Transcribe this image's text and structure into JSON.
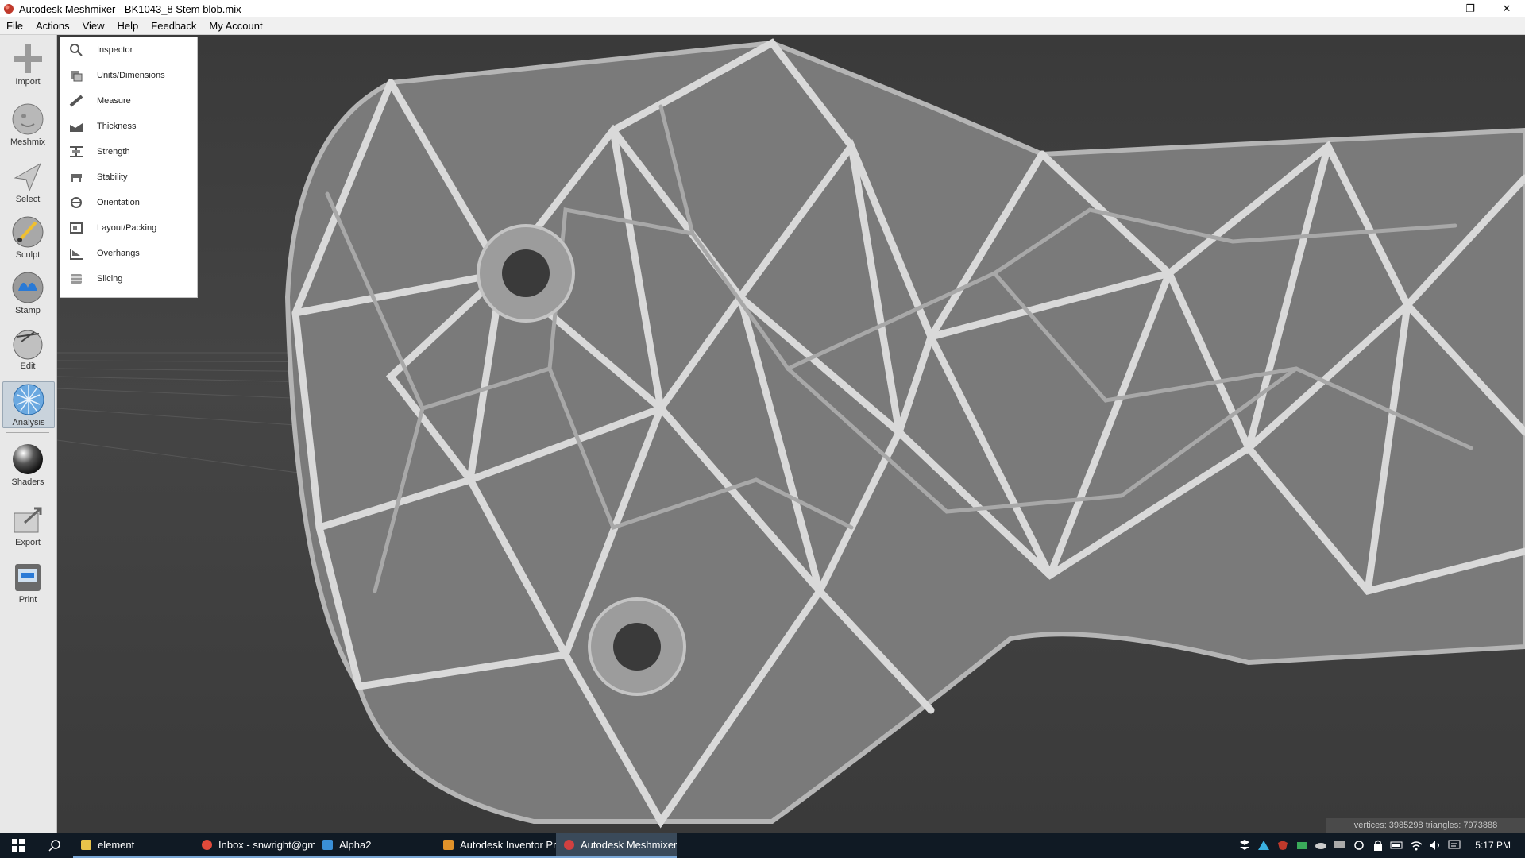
{
  "window": {
    "title": "Autodesk Meshmixer - BK1043_8 Stem blob.mix",
    "minimize_glyph": "—",
    "restore_glyph": "❐",
    "close_glyph": "✕"
  },
  "menubar": {
    "items": [
      "File",
      "Actions",
      "View",
      "Help",
      "Feedback",
      "My Account"
    ]
  },
  "toolbar": {
    "tools": [
      {
        "label": "Import",
        "icon": "import-icon"
      },
      {
        "label": "Meshmix",
        "icon": "meshmix-icon"
      },
      {
        "label": "Select",
        "icon": "select-icon"
      },
      {
        "label": "Sculpt",
        "icon": "sculpt-icon"
      },
      {
        "label": "Stamp",
        "icon": "stamp-icon"
      },
      {
        "label": "Edit",
        "icon": "edit-icon"
      },
      {
        "label": "Analysis",
        "icon": "analysis-icon",
        "active": true
      },
      {
        "label": "Shaders",
        "icon": "shaders-icon"
      },
      {
        "label": "Export",
        "icon": "export-icon"
      },
      {
        "label": "Print",
        "icon": "print-icon"
      }
    ]
  },
  "analysis_menu": {
    "items": [
      {
        "label": "Inspector",
        "icon": "inspector-icon"
      },
      {
        "label": "Units/Dimensions",
        "icon": "units-icon"
      },
      {
        "label": "Measure",
        "icon": "measure-icon"
      },
      {
        "label": "Thickness",
        "icon": "thickness-icon"
      },
      {
        "label": "Strength",
        "icon": "strength-icon"
      },
      {
        "label": "Stability",
        "icon": "stability-icon"
      },
      {
        "label": "Orientation",
        "icon": "orientation-icon"
      },
      {
        "label": "Layout/Packing",
        "icon": "layout-icon"
      },
      {
        "label": "Overhangs",
        "icon": "overhangs-icon"
      },
      {
        "label": "Slicing",
        "icon": "slicing-icon"
      }
    ]
  },
  "viewport": {
    "status": "vertices: 3985298 triangles: 7973888"
  },
  "taskbar": {
    "apps": [
      {
        "label": "element",
        "color": "#e8c34a"
      },
      {
        "label": "Inbox - snwright@gm...",
        "color": "#e04a3a"
      },
      {
        "label": "Alpha2",
        "color": "#3a8fd6"
      },
      {
        "label": "Autodesk Inventor Pr...",
        "color": "#e0922a"
      },
      {
        "label": "Autodesk Meshmixer ...",
        "color": "#d04040",
        "active": true
      }
    ],
    "clock": "5:17 PM"
  },
  "colors": {
    "viewport_bg": "#3c3c3c",
    "mesh": "#d8d8d8",
    "toolbar_bg": "#e8e8e8",
    "taskbar_bg": "#101a24"
  }
}
